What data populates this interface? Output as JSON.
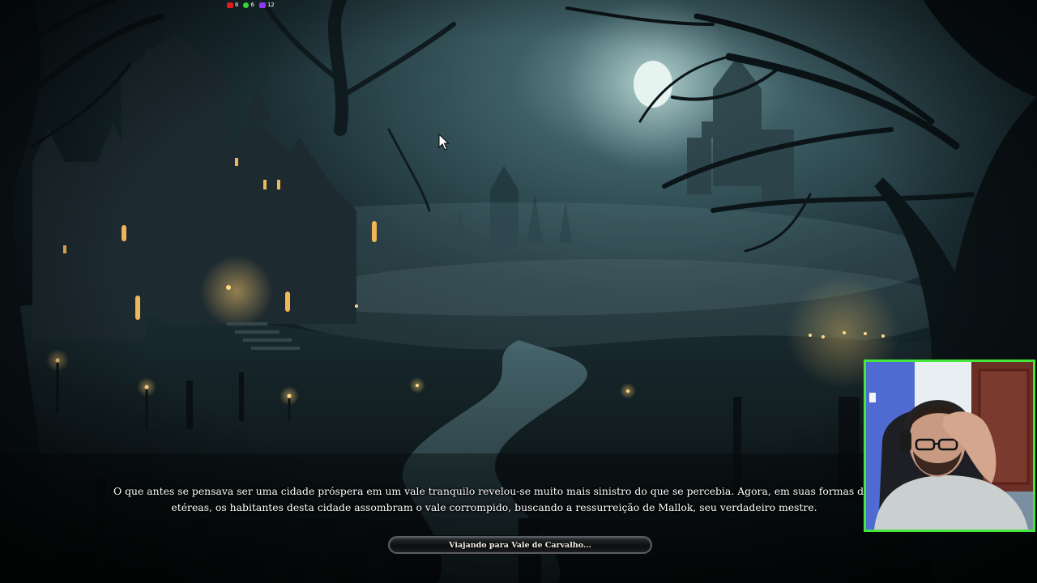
{
  "stream_stats": [
    {
      "icon": "youtube-icon",
      "count": "6",
      "color": "#e11a1a"
    },
    {
      "icon": "kick-icon",
      "count": "6",
      "color": "#35d631"
    },
    {
      "icon": "twitch-icon",
      "count": "12",
      "color": "#8d3be8"
    }
  ],
  "lore": {
    "line1": "O que antes se pensava ser uma cidade próspera em um vale tranquilo revelou-se muito mais sinistro do que se percebia. Agora, em suas formas de a",
    "line2": "etéreas, os habitantes desta cidade assombram o vale corrompido, buscando a ressurreição de Mallok, seu verdadeiro mestre."
  },
  "loading": {
    "label": "Viajando para Vale de Carvalho..."
  },
  "webcam": {
    "border_color": "#45e63c"
  },
  "scene": {
    "name": "haunted-valley-loading-art",
    "cursor": "arrow-cursor-icon"
  }
}
